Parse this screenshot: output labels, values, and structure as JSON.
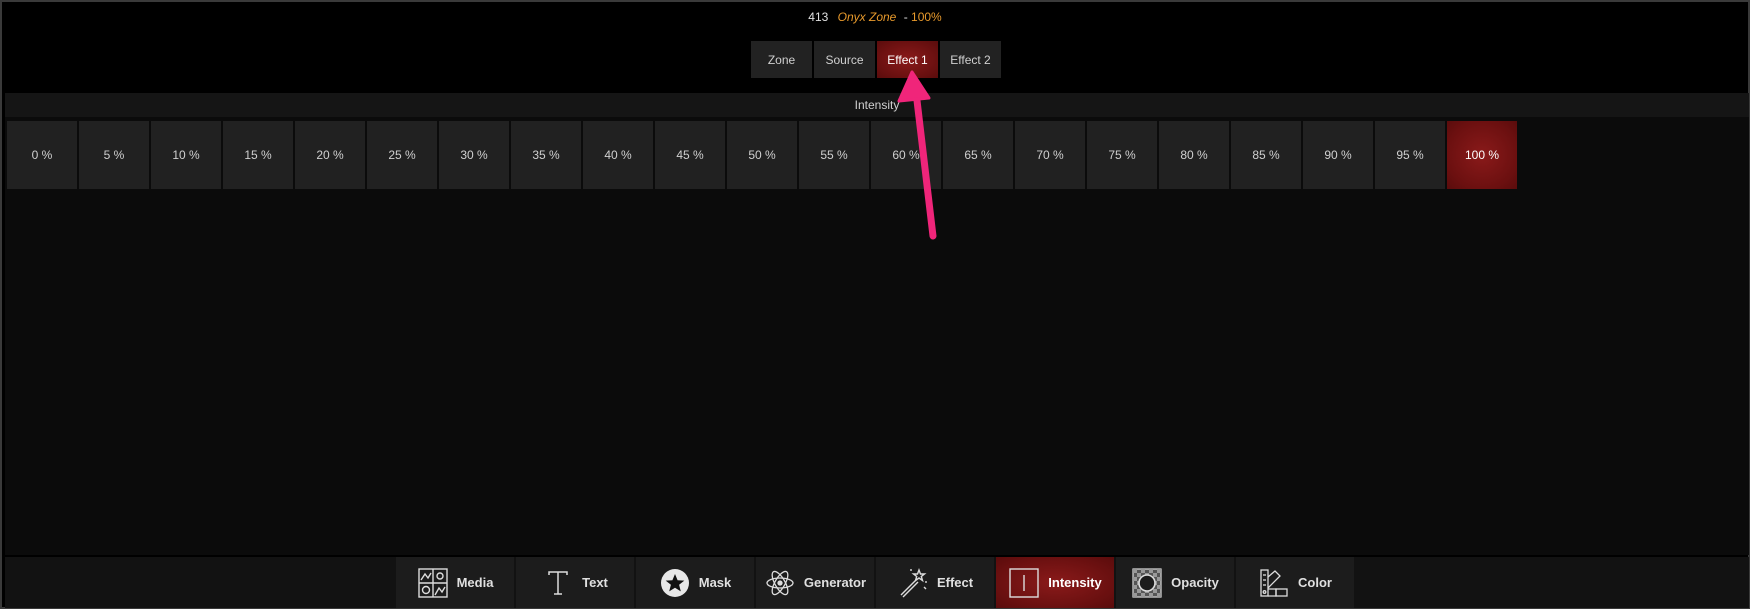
{
  "header": {
    "zone_number": "413",
    "zone_name": "Onyx Zone",
    "separator": "-",
    "zone_level": "100%"
  },
  "tabs": [
    {
      "label": "Zone",
      "active": false
    },
    {
      "label": "Source",
      "active": false
    },
    {
      "label": "Effect 1",
      "active": true
    },
    {
      "label": "Effect 2",
      "active": false
    }
  ],
  "section": {
    "title": "Intensity"
  },
  "levels": [
    {
      "label": "0 %",
      "active": false
    },
    {
      "label": "5 %",
      "active": false
    },
    {
      "label": "10 %",
      "active": false
    },
    {
      "label": "15 %",
      "active": false
    },
    {
      "label": "20 %",
      "active": false
    },
    {
      "label": "25 %",
      "active": false
    },
    {
      "label": "30 %",
      "active": false
    },
    {
      "label": "35 %",
      "active": false
    },
    {
      "label": "40 %",
      "active": false
    },
    {
      "label": "45 %",
      "active": false
    },
    {
      "label": "50 %",
      "active": false
    },
    {
      "label": "55 %",
      "active": false
    },
    {
      "label": "60 %",
      "active": false
    },
    {
      "label": "65 %",
      "active": false
    },
    {
      "label": "70 %",
      "active": false
    },
    {
      "label": "75 %",
      "active": false
    },
    {
      "label": "80 %",
      "active": false
    },
    {
      "label": "85 %",
      "active": false
    },
    {
      "label": "90 %",
      "active": false
    },
    {
      "label": "95 %",
      "active": false
    },
    {
      "label": "100 %",
      "active": true
    }
  ],
  "toolbar": [
    {
      "label": "Media",
      "icon": "media-icon",
      "active": false
    },
    {
      "label": "Text",
      "icon": "text-icon",
      "active": false
    },
    {
      "label": "Mask",
      "icon": "mask-star-icon",
      "active": false
    },
    {
      "label": "Generator",
      "icon": "generator-atom-icon",
      "active": false
    },
    {
      "label": "Effect",
      "icon": "effect-wand-icon",
      "active": false
    },
    {
      "label": "Intensity",
      "icon": "intensity-icon",
      "active": true
    },
    {
      "label": "Opacity",
      "icon": "opacity-icon",
      "active": false
    },
    {
      "label": "Color",
      "icon": "color-swatch-icon",
      "active": false
    }
  ],
  "colors": {
    "accent_active": "#7a1414",
    "zone_name": "#e89a2c",
    "annotation_arrow": "#f0257a"
  }
}
